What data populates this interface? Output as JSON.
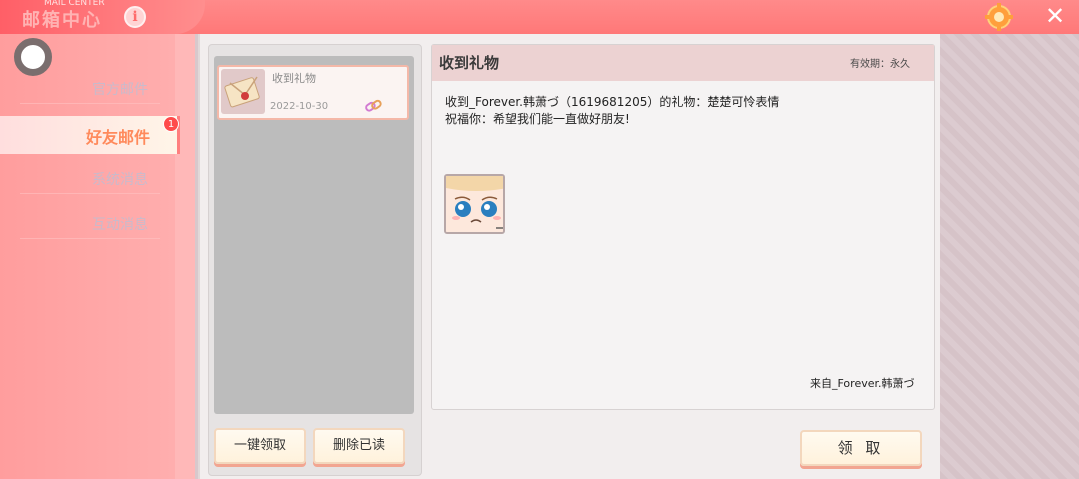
{
  "header": {
    "title": "邮箱中心",
    "subtitle_small": "MAIL CENTER"
  },
  "sidebar": {
    "items": [
      {
        "label": "官方邮件",
        "active": false
      },
      {
        "label": "好友邮件",
        "active": true,
        "badge": "1"
      },
      {
        "label": "系统消息",
        "active": false
      },
      {
        "label": "互动消息",
        "active": false
      }
    ]
  },
  "mail_list": {
    "items": [
      {
        "title": "收到礼物",
        "date": "2022-10-30"
      }
    ],
    "one_key_claim": "一键领取",
    "delete_read": "删除已读"
  },
  "detail": {
    "title": "收到礼物",
    "validity": "有效期：永久",
    "line1": "收到_Forever.韩萧づ（1619681205）的礼物：楚楚可怜表情",
    "line2": "祝福你：希望我们能一直做好朋友!",
    "sender": "来自_Forever.韩萧づ",
    "claim": "领 取"
  },
  "colors": {
    "topbar": "#ff7f7f",
    "accent": "#ff8a5c",
    "badge": "#ff4b4b"
  }
}
